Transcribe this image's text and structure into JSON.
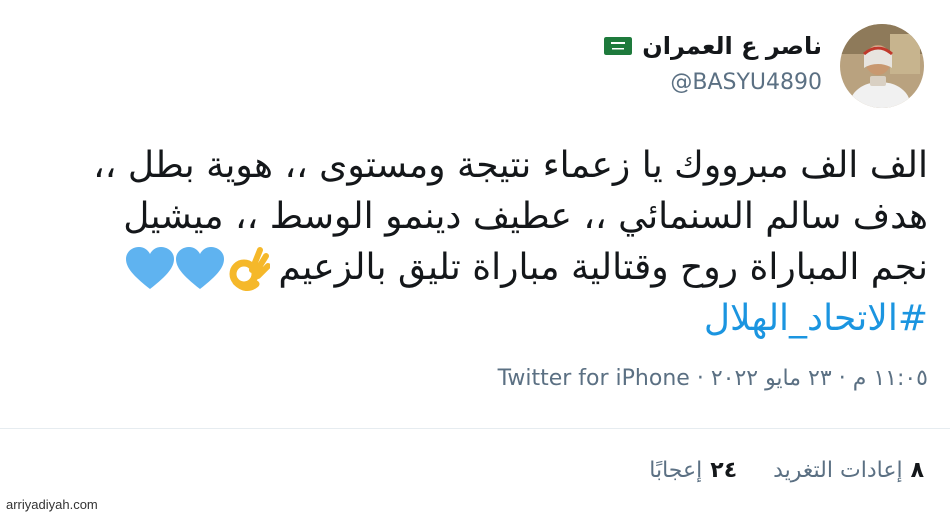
{
  "author": {
    "display_name": "ناصر ع العمران",
    "handle": "@BASYU4890",
    "flag_icon": "saudi-flag-icon",
    "avatar_icon": "profile-photo"
  },
  "tweet": {
    "line1": "الف الف مبرووك يا زعماء نتيجة ومستوى ،، هوية بطل ،،",
    "line2": "هدف سالم السنمائي ،، عطيف دينمو الوسط ،، ميشيل",
    "line3": "نجم المباراة روح وقتالية مباراة تليق بالزعيم",
    "emojis": [
      "ok-hand-emoji",
      "blue-heart-emoji",
      "blue-heart-emoji"
    ],
    "hashtag": "#الاتحاد_الهلال"
  },
  "meta": {
    "time": "١١:٠٥ م",
    "separator": "·",
    "date": "٢٣ مايو ٢٠٢٢",
    "source": "Twitter for iPhone"
  },
  "stats": {
    "retweets_count": "٨",
    "retweets_label": "إعادات التغريد",
    "likes_count": "٢٤",
    "likes_label": "إعجابًا"
  },
  "colors": {
    "link": "#1b95e0",
    "secondary_text": "#5b7083",
    "primary_text": "#14171a",
    "heart": "#5fb3f0",
    "ok_hand": "#ffcc33"
  },
  "watermark": "arriyadiyah.com"
}
